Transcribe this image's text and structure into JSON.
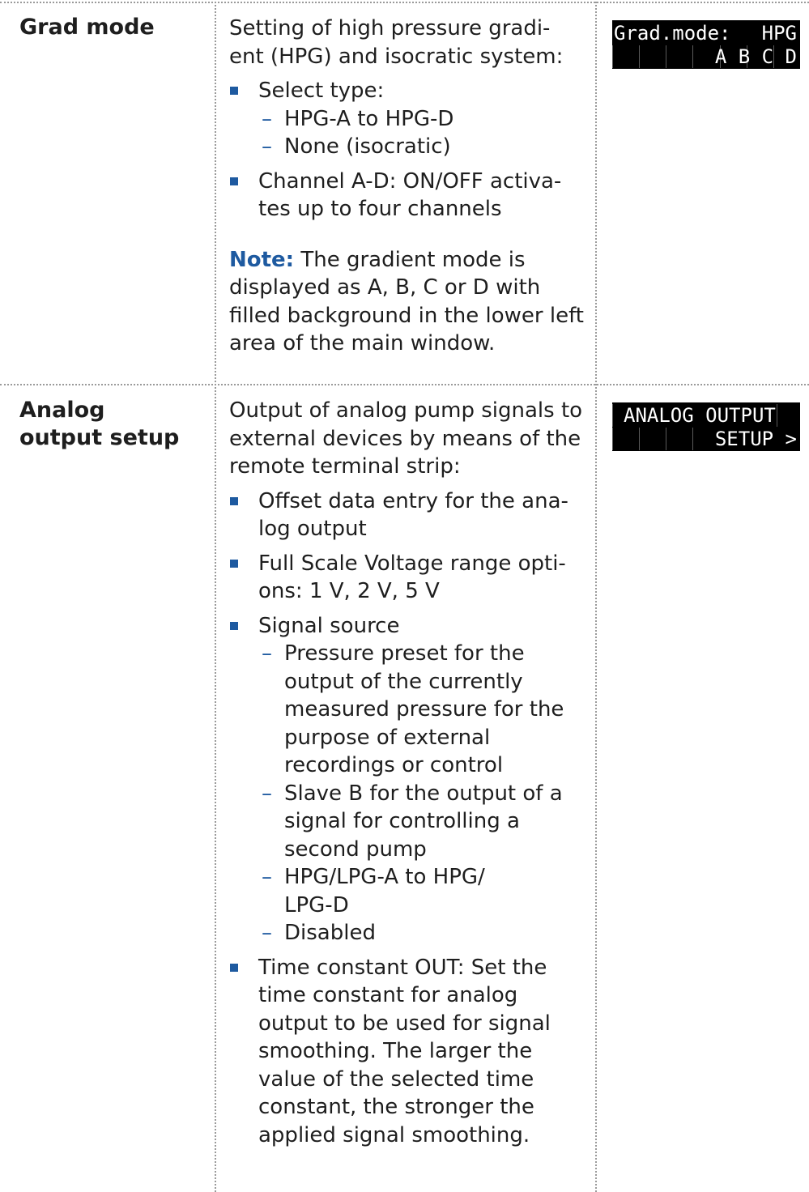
{
  "rows": [
    {
      "parameter": "Grad mode",
      "intro": "Setting of high pressure gradi-\nent (HPG) and isocratic system:",
      "bullets": [
        {
          "text": "Select type:",
          "sub": [
            "HPG-A to HPG-D",
            "None (isocratic)"
          ]
        },
        {
          "text": "Channel A-D: ON/OFF activa-\ntes up to four channels",
          "sub": []
        }
      ],
      "note_label": "Note:",
      "note_text": "The gradient mode is displayed as A, B, C or D with filled background in the lower left area of the main window.",
      "display": {
        "line1_left": "Grad.mode:",
        "line1_right": "HPG",
        "line2_right": "A B C D"
      }
    },
    {
      "parameter": "Analog output setup",
      "intro": "Output of analog pump signals to external devices by means of the remote terminal strip:",
      "bullets": [
        {
          "text": "Offset data entry for the ana-\nlog output",
          "sub": []
        },
        {
          "text": "Full Scale Voltage range opti-\nons: 1 V, 2 V, 5 V",
          "sub": []
        },
        {
          "text": "Signal source",
          "sub": [
            "Pressure preset for the output of the currently measured pressure for the purpose of external recordings or control",
            "Slave B for the output of a signal for controlling a second pump",
            "HPG/LPG-A to HPG/\nLPG-D",
            "Disabled"
          ]
        },
        {
          "text": "Time constant OUT: Set the time constant for analog output to be used for signal smoothing. The larger the value of the selected time constant, the stronger the applied signal smoothing.",
          "sub": []
        }
      ],
      "display": {
        "line1_left": "ANALOG OUTPUT",
        "line2_right": "SETUP >"
      }
    }
  ]
}
